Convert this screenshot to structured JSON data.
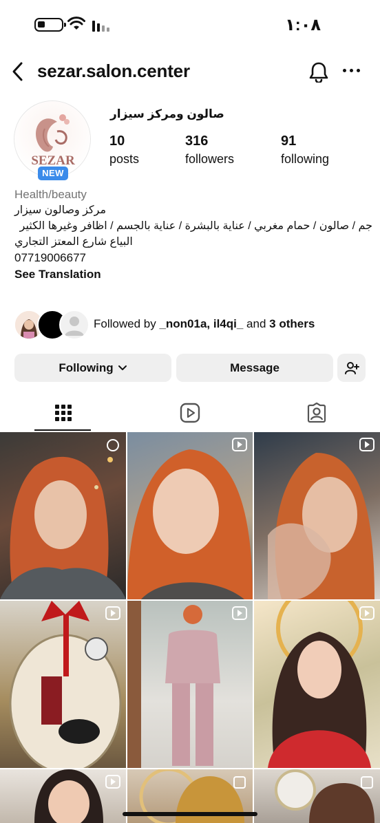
{
  "status_bar": {
    "time": "١:٠٨"
  },
  "header": {
    "username": "sezar.salon.center"
  },
  "profile": {
    "display_name": "صالون ومركز سيزار",
    "avatar_text": "SEZAR",
    "new_badge": "NEW",
    "stats": [
      {
        "value": "10",
        "label": "posts"
      },
      {
        "value": "316",
        "label": "followers"
      },
      {
        "value": "91",
        "label": "following"
      }
    ]
  },
  "bio": {
    "category": "Health/beauty",
    "lines": [
      "مركز وصالون سيزار",
      "جم / صالون / حمام مغربي / عناية بالبشرة / عناية بالجسم / اظافر وغيرها الكثير",
      "البياع شارع المعتز التجاري"
    ],
    "phone": "07719006677",
    "see_translation": "See Translation"
  },
  "followed_by": {
    "prefix": "Followed by ",
    "names": "_non01a, il4qi_",
    "joiner": " and ",
    "others": "3 others"
  },
  "actions": {
    "following": "Following",
    "message": "Message"
  },
  "colors": {
    "badge": "#3b8bea",
    "button_bg": "#efefef",
    "secondary_text": "#737373"
  }
}
